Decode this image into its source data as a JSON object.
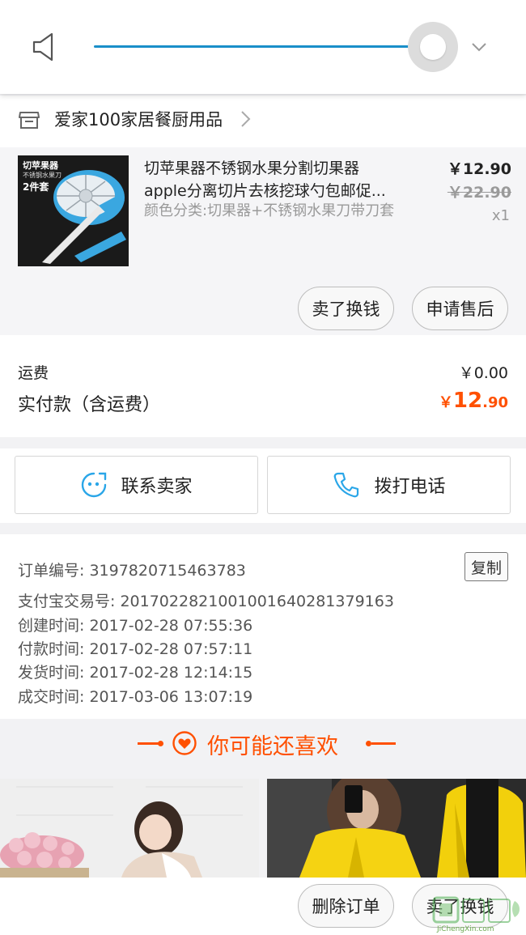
{
  "colors": {
    "accent_orange": "#ff5000",
    "volume_blue": "#1a8fc9",
    "contact_icon_blue": "#2aa6e8"
  },
  "volume": {
    "level": 0.92,
    "icons": [
      "speaker-icon",
      "chevron-down-icon"
    ]
  },
  "shop": {
    "name": "爱家100家居餐厨用品",
    "icon": "store-icon"
  },
  "product": {
    "thumb_title": "切苹果器",
    "thumb_sub": "不锈钢水果刀",
    "thumb_count": "2件套",
    "title_line1": "切苹果器不锈钢水果分割切果器",
    "title_line2": "apple分离切片去核挖球勺包邮促...",
    "spec": "颜色分类:切果器+不锈钢水果刀带刀套",
    "price_now": "￥12.90",
    "price_old": "￥22.90",
    "quantity": "x1",
    "btn_sell": "卖了换钱",
    "btn_aftersale": "申请售后"
  },
  "summary": {
    "shipping_label": "运费",
    "shipping_value": "￥0.00",
    "total_label": "实付款（含运费）",
    "total_yen": "￥",
    "total_int": "12",
    "total_dec": ".90"
  },
  "contact": {
    "seller_label": "联系卖家",
    "phone_label": "拨打电话"
  },
  "order": {
    "copy_label": "复制",
    "rows": [
      {
        "key": "订单编号: ",
        "value": "3197820715463783"
      },
      {
        "key": "支付宝交易号: ",
        "value": "2017022821001001640281379163"
      },
      {
        "key": "创建时间: ",
        "value": "2017-02-28 07:55:36"
      },
      {
        "key": "付款时间: ",
        "value": "2017-02-28 07:57:11"
      },
      {
        "key": "发货时间: ",
        "value": "2017-02-28 12:14:15"
      },
      {
        "key": "成交时间: ",
        "value": "2017-03-06 13:07:19"
      }
    ]
  },
  "recommend": {
    "title": "你可能还喜欢"
  },
  "bottom": {
    "btn_delete": "删除订单",
    "btn_sell": "卖了换钱"
  },
  "watermark": {
    "text": "JiChengXin.com"
  }
}
